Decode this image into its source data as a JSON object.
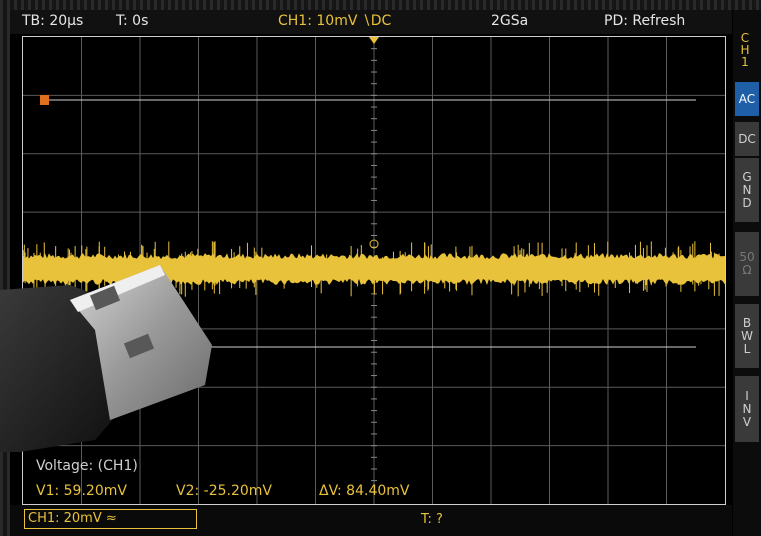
{
  "header": {
    "timebase": "TB: 20μs",
    "trigger_offset": "T: 0s",
    "channel": "CH1: 10mV ∖DC",
    "sample_rate": "2GSa",
    "mode": "PD: Refresh"
  },
  "sidebar": {
    "channel_label": [
      "C",
      "H",
      "1"
    ],
    "buttons": [
      {
        "name": "ac",
        "label": "AC",
        "active": true
      },
      {
        "name": "dc",
        "label": "DC",
        "active": false
      },
      {
        "name": "gnd",
        "label": "G\nN\nD",
        "active": false
      },
      {
        "name": "50ohm",
        "label": "50\nΩ",
        "active": false
      },
      {
        "name": "bwl",
        "label": "B\nW\nL",
        "active": false
      },
      {
        "name": "inv",
        "label": "I\nN\nV",
        "active": false
      }
    ]
  },
  "cursor_readout": {
    "title": "Voltage: (CH1)",
    "v1": "V1: 59.20mV",
    "v2": "V2: -25.20mV",
    "delta": "ΔV: 84.40mV"
  },
  "footer": {
    "channel_setting": "CH1: 20mV ≈",
    "trigger_status": "T: ?"
  },
  "colors": {
    "trace": "#e8c23a",
    "active_button": "#1f5fa8",
    "grid": "#5a5a5a"
  }
}
